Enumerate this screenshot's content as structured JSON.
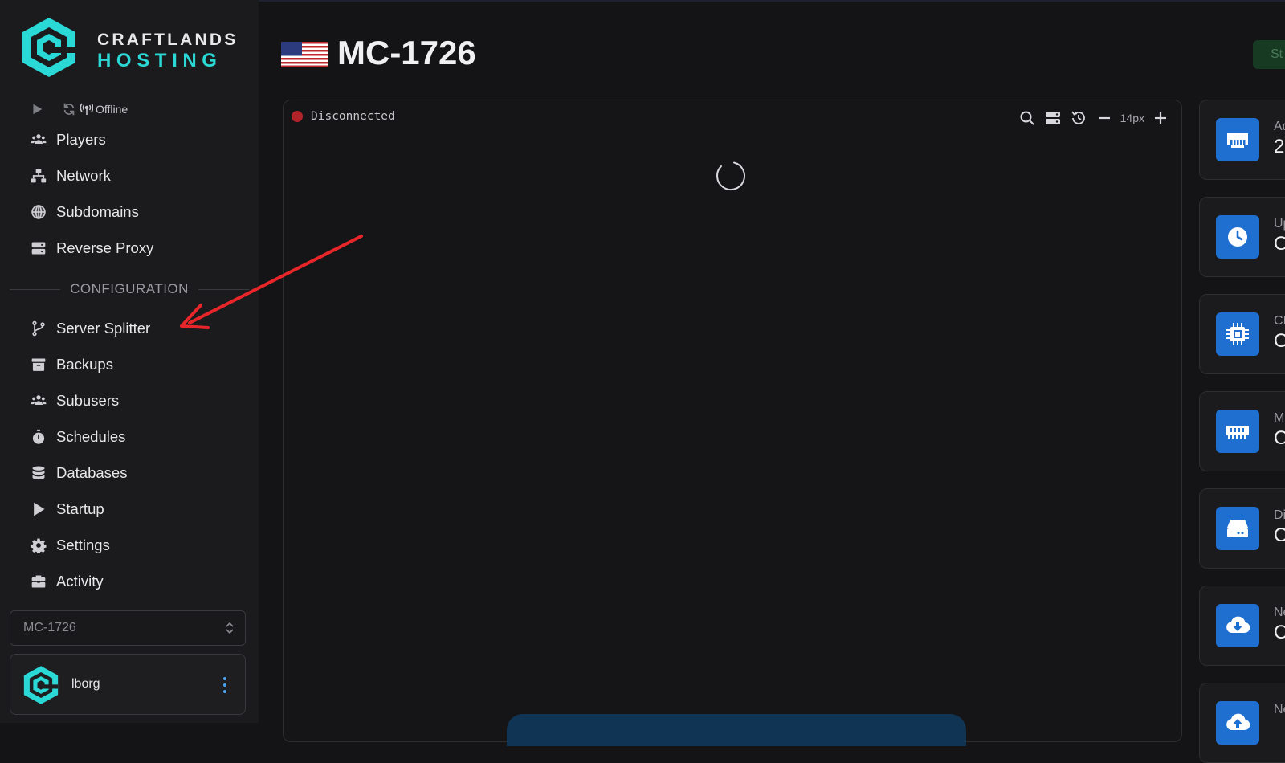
{
  "brand": {
    "name_line1": "CRAFTLANDS",
    "name_line2": "HOSTING",
    "accent_color": "#2ad8d6"
  },
  "sidebar": {
    "status_text": "Offline",
    "items_top": [
      {
        "label": "Players",
        "icon": "users-icon"
      },
      {
        "label": "Network",
        "icon": "network-icon"
      },
      {
        "label": "Subdomains",
        "icon": "globe-icon"
      },
      {
        "label": "Reverse Proxy",
        "icon": "server-icon"
      }
    ],
    "section_label": "CONFIGURATION",
    "items_config": [
      {
        "label": "Server Splitter",
        "icon": "branch-icon"
      },
      {
        "label": "Backups",
        "icon": "archive-icon"
      },
      {
        "label": "Subusers",
        "icon": "users-icon"
      },
      {
        "label": "Schedules",
        "icon": "stopwatch-icon"
      },
      {
        "label": "Databases",
        "icon": "database-icon"
      },
      {
        "label": "Startup",
        "icon": "play-icon"
      },
      {
        "label": "Settings",
        "icon": "gear-icon"
      },
      {
        "label": "Activity",
        "icon": "briefcase-icon"
      }
    ],
    "server_select": {
      "value": "MC-1726"
    },
    "user": {
      "name": "lborg"
    }
  },
  "header": {
    "title": "MC-1726",
    "flag": "us-flag-icon",
    "action_partial": "St"
  },
  "console": {
    "status_text": "Disconnected",
    "status_color": "#b3232a",
    "font_size_label": "14px"
  },
  "stats": [
    {
      "label": "Ad",
      "value": "2:",
      "icon": "ethernet-icon"
    },
    {
      "label": "Up",
      "value": "O",
      "icon": "clock-icon"
    },
    {
      "label": "CI",
      "value": "O",
      "icon": "cpu-icon"
    },
    {
      "label": "M",
      "value": "O",
      "icon": "memory-icon"
    },
    {
      "label": "Di",
      "value": "O",
      "icon": "disk-icon"
    },
    {
      "label": "Ne",
      "value": "O",
      "icon": "cloud-download-icon"
    },
    {
      "label": "Ne",
      "value": "",
      "icon": "cloud-upload-icon"
    }
  ],
  "colors": {
    "stat_icon_bg": "#1f6fd1",
    "annotation_arrow": "#e8262a"
  }
}
